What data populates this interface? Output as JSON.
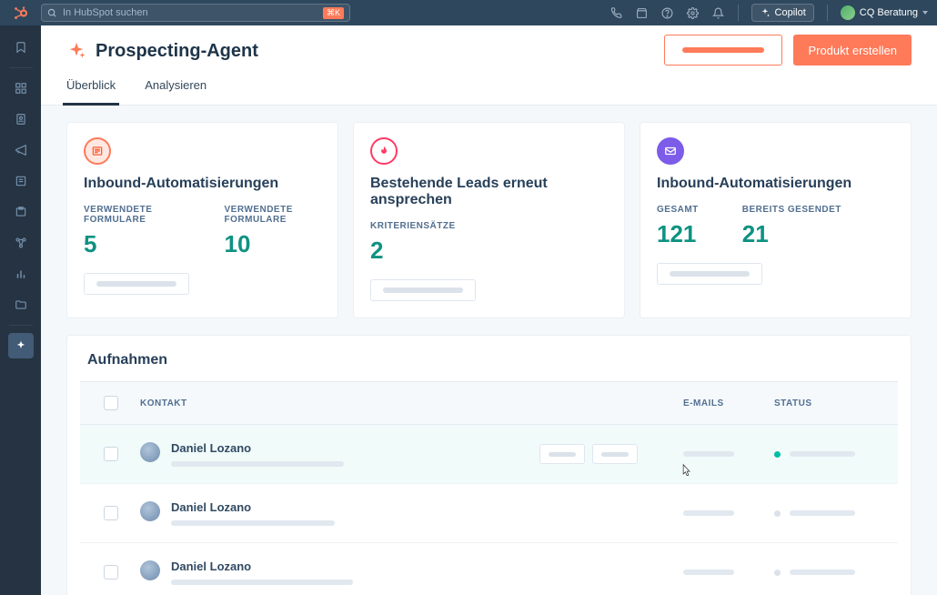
{
  "topbar": {
    "search_placeholder": "In HubSpot suchen",
    "kbd": "⌘K",
    "copilot_label": "Copilot",
    "account_label": "CQ Beratung"
  },
  "page": {
    "title": "Prospecting-Agent",
    "primary_button": "Produkt erstellen"
  },
  "tabs": {
    "overview": "Überblick",
    "analyze": "Analysieren"
  },
  "cards": {
    "inbound": {
      "title": "Inbound-Automatisierungen",
      "stat1_label": "VERWENDETE FORMULARE",
      "stat1_value": "5",
      "stat2_label": "VERWENDETE FORMULARE",
      "stat2_value": "10"
    },
    "existing": {
      "title": "Bestehende Leads erneut ansprechen",
      "stat1_label": "KRITERIENSÄTZE",
      "stat1_value": "2"
    },
    "inbound2": {
      "title": "Inbound-Automatisierungen",
      "stat1_label": "GESAMT",
      "stat1_value": "121",
      "stat2_label": "BEREITS GESENDET",
      "stat2_value": "21"
    }
  },
  "section": {
    "title": "Aufnahmen",
    "columns": {
      "contact": "KONTAKT",
      "emails": "E-MAILS",
      "status": "STATUS"
    },
    "rows": [
      {
        "name": "Daniel Lozano",
        "status_active": true
      },
      {
        "name": "Daniel Lozano",
        "status_active": false
      },
      {
        "name": "Daniel Lozano",
        "status_active": false
      }
    ]
  }
}
